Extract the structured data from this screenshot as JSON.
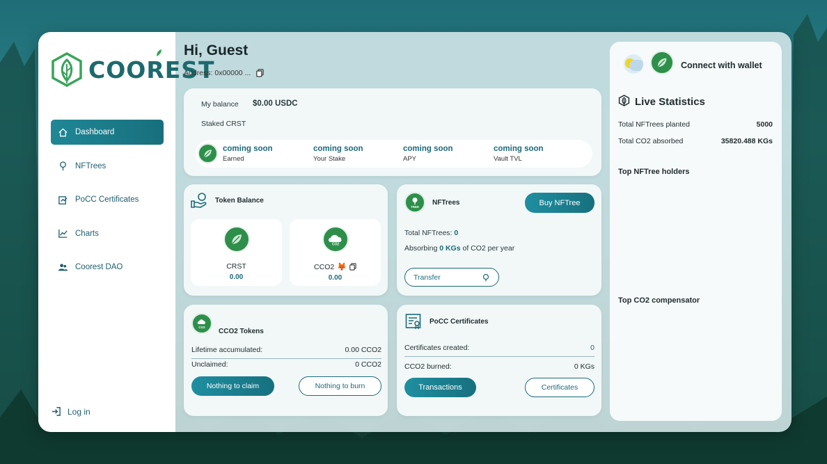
{
  "brand": {
    "name": "COOREST"
  },
  "sidebar": {
    "items": [
      {
        "label": "Dashboard",
        "icon": "home-icon"
      },
      {
        "label": "NFTrees",
        "icon": "tree-icon"
      },
      {
        "label": "PoCC Certificates",
        "icon": "certificate-icon"
      },
      {
        "label": "Charts",
        "icon": "chart-icon"
      },
      {
        "label": "Coorest DAO",
        "icon": "users-icon"
      }
    ],
    "login_label": "Log in"
  },
  "header": {
    "greeting": "Hi, Guest",
    "address": "Address: 0x00000 ..."
  },
  "balance_card": {
    "balance_label": "My balance",
    "balance_value": "$0.00 USDC",
    "staked_label": "Staked CRST",
    "stats": [
      {
        "value": "coming soon",
        "label": "Earned"
      },
      {
        "value": "coming soon",
        "label": "Your Stake"
      },
      {
        "value": "coming soon",
        "label": "APY"
      },
      {
        "value": "coming soon",
        "label": "Vault TVL"
      }
    ]
  },
  "token_balance": {
    "title": "Token Balance",
    "tokens": [
      {
        "name": "CRST",
        "value": "0.00"
      },
      {
        "name": "CCO2",
        "value": "0.00"
      }
    ]
  },
  "nftrees": {
    "title": "NFTrees",
    "buy_label": "Buy NFTree",
    "total_label": "Total NFTrees:",
    "total_value": "0",
    "absorbing_prefix": "Absorbing",
    "absorbing_value": "0 KGs",
    "absorbing_suffix": "of CO2 per year",
    "transfer_label": "Transfer",
    "icon_text": "TREE"
  },
  "cco2_tokens": {
    "title": "CCO2 Tokens",
    "icon_text": "CO2",
    "lifetime_label": "Lifetime accumulated:",
    "lifetime_value": "0.00 CCO2",
    "unclaimed_label": "Unclaimed:",
    "unclaimed_value": "0 CCO2",
    "claim_label": "Nothing to claim",
    "burn_label": "Nothing to burn"
  },
  "pocc": {
    "title": "PoCC Certificates",
    "created_label": "Certificates created:",
    "created_value": "0",
    "burned_label": "CCO2 burned:",
    "burned_value": "0 KGs",
    "transactions_label": "Transactions",
    "certificates_label": "Certificates"
  },
  "right_panel": {
    "connect_label": "Connect with wallet",
    "live_title": "Live Statistics",
    "planted_label": "Total NFTrees planted",
    "planted_value": "5000",
    "absorbed_label": "Total CO2 absorbed",
    "absorbed_value": "35820.488 KGs",
    "holders_title": "Top NFTree holders",
    "compensator_title": "Top CO2 compensator"
  },
  "colors": {
    "accent": "#1c6a7a",
    "brand_green": "#3aa35a",
    "button": "#1f8795"
  }
}
